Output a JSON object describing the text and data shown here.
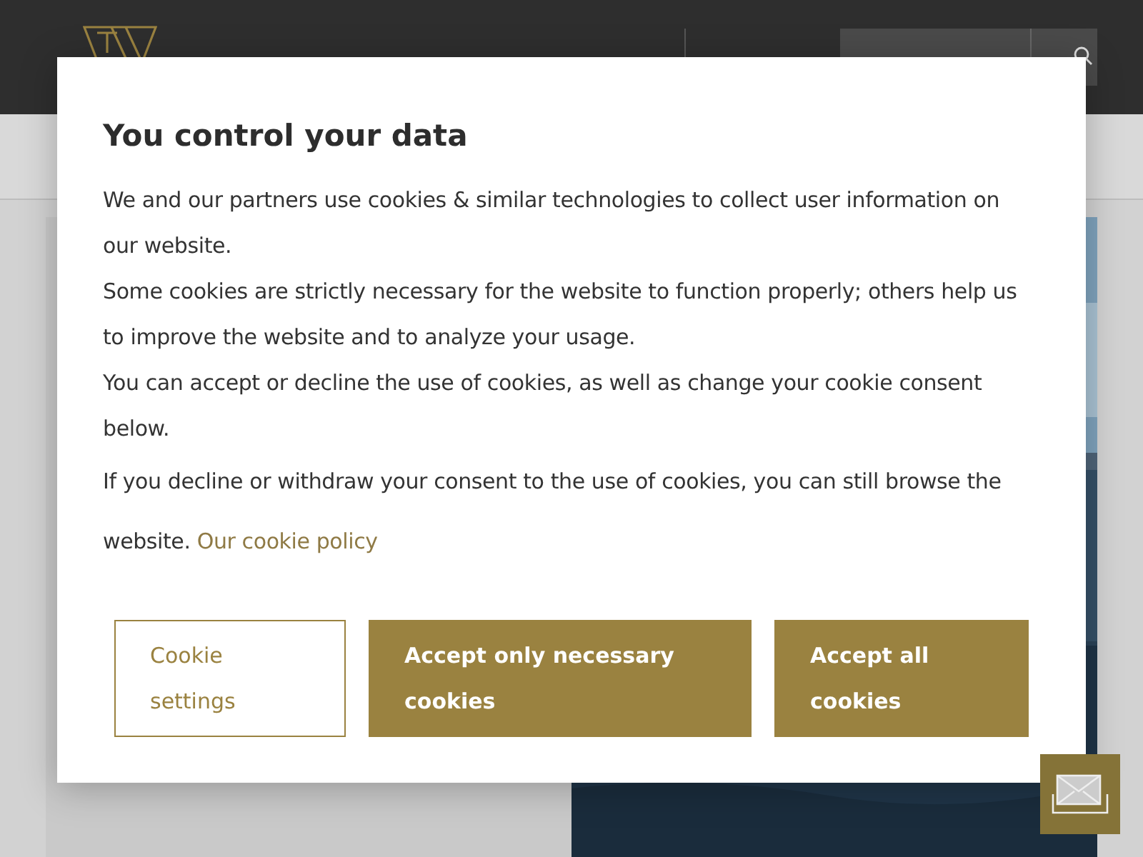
{
  "dialog": {
    "title": "You control your data",
    "paragraphs": [
      "We and our partners use cookies & similar technologies to collect user information on our website.",
      "Some cookies are strictly necessary for the website to function properly; others help us to improve the website and to analyze your usage.",
      "You can accept or decline the use of cookies, as well as change your cookie consent below.",
      "If you decline or withdraw your consent to the use of cookies, you can still browse the website."
    ],
    "link": "Our cookie policy",
    "buttons": [
      {
        "label": "Cookie settings",
        "kind": "outline"
      },
      {
        "label": "Accept only necessary cookies",
        "kind": "filled"
      },
      {
        "label": "Accept all cookies",
        "kind": "filled"
      }
    ]
  }
}
